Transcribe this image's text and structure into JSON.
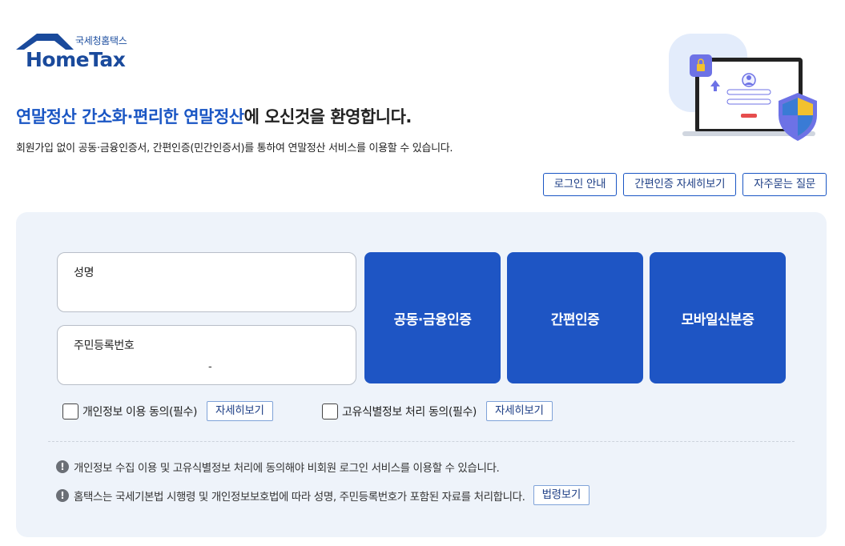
{
  "brand": {
    "sub": "국세청홈택스",
    "main": "HomeTax"
  },
  "hero": {
    "title_highlight": "연말정산 간소화·편리한 연말정산",
    "title_rest": "에 오신것을 환영합니다.",
    "description": "회원가입 없이 공동·금융인증서, 간편인증(민간인증서)를 통하여 연말정산 서비스를 이용할 수 있습니다."
  },
  "top_links": {
    "login_guide": "로그인 안내",
    "simple_auth_detail": "간편인증 자세히보기",
    "faq": "자주묻는 질문"
  },
  "form": {
    "name_label": "성명",
    "rrn_label": "주민등록번호",
    "rrn_separator": "-"
  },
  "auth_buttons": {
    "joint_financial": "공동·금융인증",
    "simple": "간편인증",
    "mobile_id": "모바일신분증"
  },
  "agreements": {
    "privacy_label": "개인정보 이용 동의(필수)",
    "unique_id_label": "고유식별정보 처리 동의(필수)",
    "detail_button": "자세히보기"
  },
  "notices": {
    "n1": "개인정보 수집 이용 및 고유식별정보 처리에 동의해야 비회원 로그인 서비스를 이용할 수 있습니다.",
    "n2": "홈택스는 국세기본법 시행령 및 개인정보보호법에 따라 성명, 주민등록번호가 포함된 자료를 처리합니다.",
    "law_button": "법령보기",
    "icon_glyph": "!"
  },
  "colors": {
    "accent": "#1e55c4",
    "panel_bg": "#eef3fa",
    "link_border": "#1a56c4"
  }
}
